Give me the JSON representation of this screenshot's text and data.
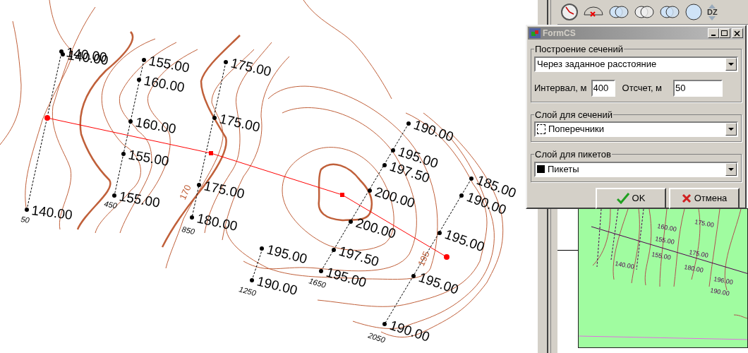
{
  "toolbar": [
    {
      "kind": "clock"
    },
    {
      "kind": "arc"
    },
    {
      "kind": "union"
    },
    {
      "kind": "intersect"
    },
    {
      "kind": "subtract"
    },
    {
      "kind": "circle"
    },
    {
      "kind": "dz",
      "label": "DZ"
    }
  ],
  "map": {
    "labels": [
      {
        "kind": "elevation",
        "text": "140.00"
      },
      {
        "kind": "elevation",
        "text": "140.00"
      },
      {
        "kind": "elevation",
        "text": "140.00"
      },
      {
        "kind": "elevation",
        "text": "155.00"
      },
      {
        "kind": "elevation",
        "text": "160.00"
      },
      {
        "kind": "elevation",
        "text": "160.00"
      },
      {
        "kind": "elevation",
        "text": "155.00"
      },
      {
        "kind": "elevation",
        "text": "155.00"
      },
      {
        "kind": "elevation",
        "text": "175.00"
      },
      {
        "kind": "elevation",
        "text": "175.00"
      },
      {
        "kind": "elevation",
        "text": "175.00"
      },
      {
        "kind": "elevation",
        "text": "180.00"
      },
      {
        "kind": "elevation",
        "text": "195.00"
      },
      {
        "kind": "elevation",
        "text": "190.00"
      },
      {
        "kind": "elevation",
        "text": "190.00"
      },
      {
        "kind": "elevation",
        "text": "195.00"
      },
      {
        "kind": "elevation",
        "text": "197.50"
      },
      {
        "kind": "elevation",
        "text": "200.00"
      },
      {
        "kind": "elevation",
        "text": "200.00"
      },
      {
        "kind": "elevation",
        "text": "197.50"
      },
      {
        "kind": "elevation",
        "text": "195.00"
      },
      {
        "kind": "elevation",
        "text": "185.00"
      },
      {
        "kind": "elevation",
        "text": "190.00"
      },
      {
        "kind": "elevation",
        "text": "195.00"
      },
      {
        "kind": "elevation",
        "text": "195.00"
      },
      {
        "kind": "elevation",
        "text": "190.00"
      },
      {
        "kind": "station",
        "text": "50"
      },
      {
        "kind": "station",
        "text": "450"
      },
      {
        "kind": "station",
        "text": "850"
      },
      {
        "kind": "station",
        "text": "1250"
      },
      {
        "kind": "station",
        "text": "1650"
      },
      {
        "kind": "station",
        "text": "2050"
      },
      {
        "kind": "contour",
        "text": "170"
      },
      {
        "kind": "contour",
        "text": "195"
      }
    ]
  },
  "preview": {
    "labels": [
      "160.00",
      "175.00",
      "155.00",
      "155.00",
      "175.00",
      "140.00",
      "180.00",
      "196.00",
      "190.00"
    ]
  },
  "dialog": {
    "title": "FormCS",
    "groups": [
      {
        "kind": "plain",
        "legend": "Построение сечений",
        "value": "Через заданное расстояние",
        "fields": [
          {
            "label": "Интервал, м",
            "value": "400"
          },
          {
            "label": "Отсчет, м",
            "value": "50"
          }
        ]
      },
      {
        "legend": "Слой для сечений",
        "value": "Поперечники",
        "kind": "dashed"
      },
      {
        "legend": "Слой для пикетов",
        "value": "Пикеты",
        "kind": "solid"
      }
    ],
    "buttons": [
      {
        "kind": "ok",
        "label": "OK"
      },
      {
        "kind": "cancel",
        "label": "Отмена"
      }
    ]
  }
}
